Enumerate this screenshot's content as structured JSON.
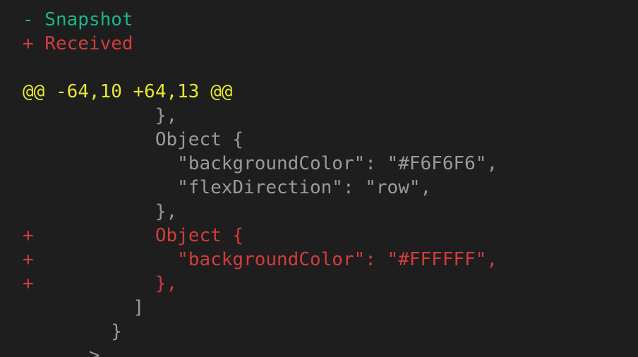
{
  "colors": {
    "background": "#1e1e1e",
    "snapshot": "#1db58a",
    "received": "#d23c3c",
    "hunk_header": "#e6e633",
    "context": "#9a9a9a"
  },
  "legend": {
    "snapshot": "- Snapshot",
    "received": "+ Received"
  },
  "hunk_header": "@@ -64,10 +64,13 @@",
  "lines": [
    "            },",
    "            Object {",
    "              \"backgroundColor\": \"#F6F6F6\",",
    "              \"flexDirection\": \"row\",",
    "            },",
    "+           Object {",
    "+             \"backgroundColor\": \"#FFFFFF\",",
    "+           },",
    "          ]",
    "        }",
    "      >"
  ]
}
